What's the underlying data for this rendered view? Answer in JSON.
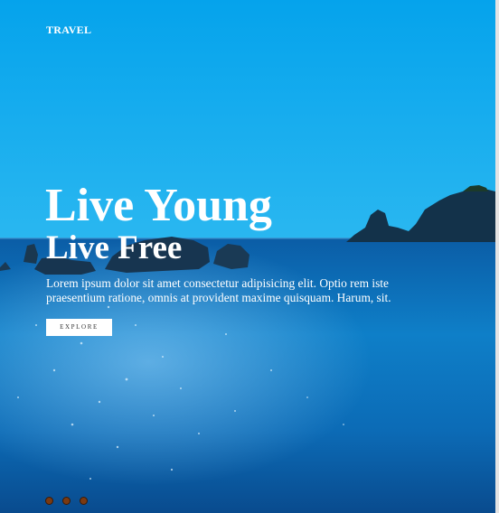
{
  "header": {
    "brand": "TRAVEL"
  },
  "hero": {
    "title": "Live Young",
    "subtitle": "Live Free",
    "description": "Lorem ipsum dolor sit amet consectetur adipisicing elit. Optio rem iste praesentium ratione, omnis at provident maxime quisquam. Harum, sit.",
    "button_label": "EXPLORE",
    "background_image": "sea-with-rocky-coastline"
  },
  "slider": {
    "dot_count": 3,
    "dot_color": "#7a3a12"
  },
  "colors": {
    "sky": "#09a5eb",
    "sea": "#0b63ad",
    "text": "#ffffff",
    "button_bg": "#ffffff"
  }
}
